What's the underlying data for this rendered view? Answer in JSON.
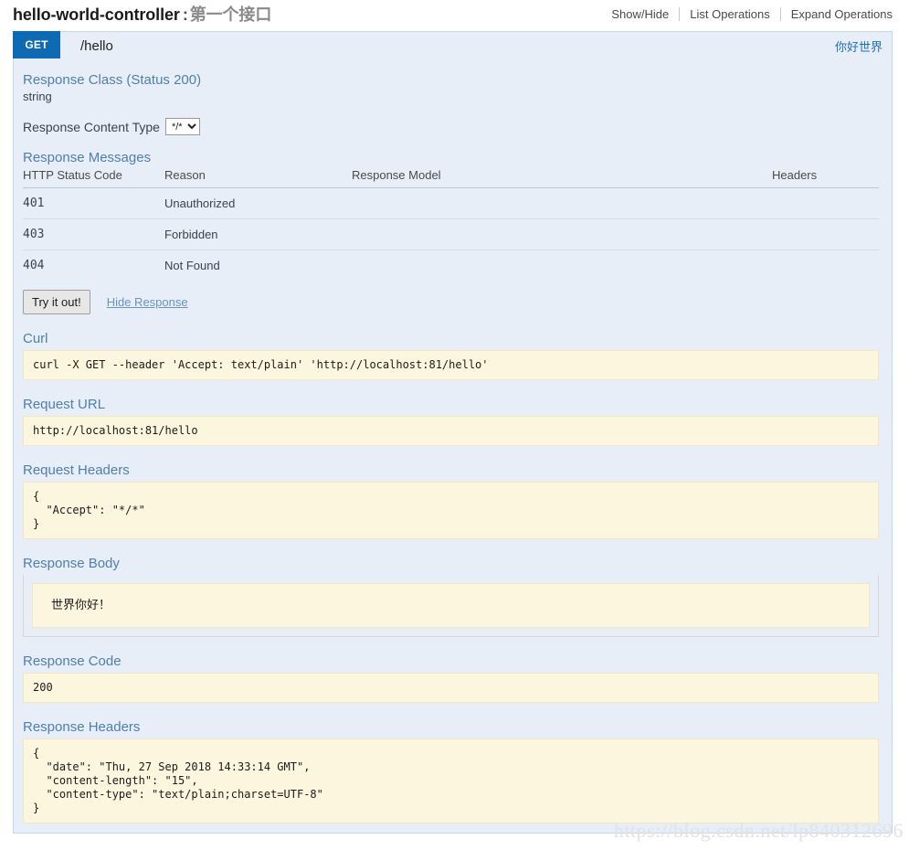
{
  "colors": {
    "method_get": "#0f6ab4",
    "panel_bg": "#e7eef7",
    "code_bg": "#fcf6df",
    "heading": "#4f7fae",
    "link": "#1f6fb8"
  },
  "resource": {
    "name": "hello-world-controller",
    "separator": ":",
    "description": "第一个接口",
    "options": [
      {
        "label": "Show/Hide"
      },
      {
        "label": "List Operations"
      },
      {
        "label": "Expand Operations"
      }
    ]
  },
  "operation": {
    "method": "GET",
    "path": "/hello",
    "summary": "你好世界",
    "response_class": {
      "heading": "Response Class (Status 200)",
      "model": "string"
    },
    "content_type": {
      "label": "Response Content Type",
      "selected": "*/*",
      "options": [
        "*/*"
      ]
    },
    "response_messages": {
      "heading": "Response Messages",
      "columns": [
        "HTTP Status Code",
        "Reason",
        "Response Model",
        "Headers"
      ],
      "rows": [
        {
          "code": "401",
          "reason": "Unauthorized",
          "model": "",
          "headers": ""
        },
        {
          "code": "403",
          "reason": "Forbidden",
          "model": "",
          "headers": ""
        },
        {
          "code": "404",
          "reason": "Not Found",
          "model": "",
          "headers": ""
        }
      ]
    },
    "actions": {
      "try_it_out": "Try it out!",
      "hide_response": "Hide Response"
    },
    "result": {
      "curl_heading": "Curl",
      "curl": "curl -X GET --header 'Accept: text/plain' 'http://localhost:81/hello'",
      "request_url_heading": "Request URL",
      "request_url": "http://localhost:81/hello",
      "request_headers_heading": "Request Headers",
      "request_headers": "{\n  \"Accept\": \"*/*\"\n}",
      "response_body_heading": "Response Body",
      "response_body": "世界你好！",
      "response_code_heading": "Response Code",
      "response_code": "200",
      "response_headers_heading": "Response Headers",
      "response_headers": "{\n  \"date\": \"Thu, 27 Sep 2018 14:33:14 GMT\",\n  \"content-length\": \"15\",\n  \"content-type\": \"text/plain;charset=UTF-8\"\n}"
    }
  },
  "watermark": "https://blog.csdn.net/lp840312696"
}
